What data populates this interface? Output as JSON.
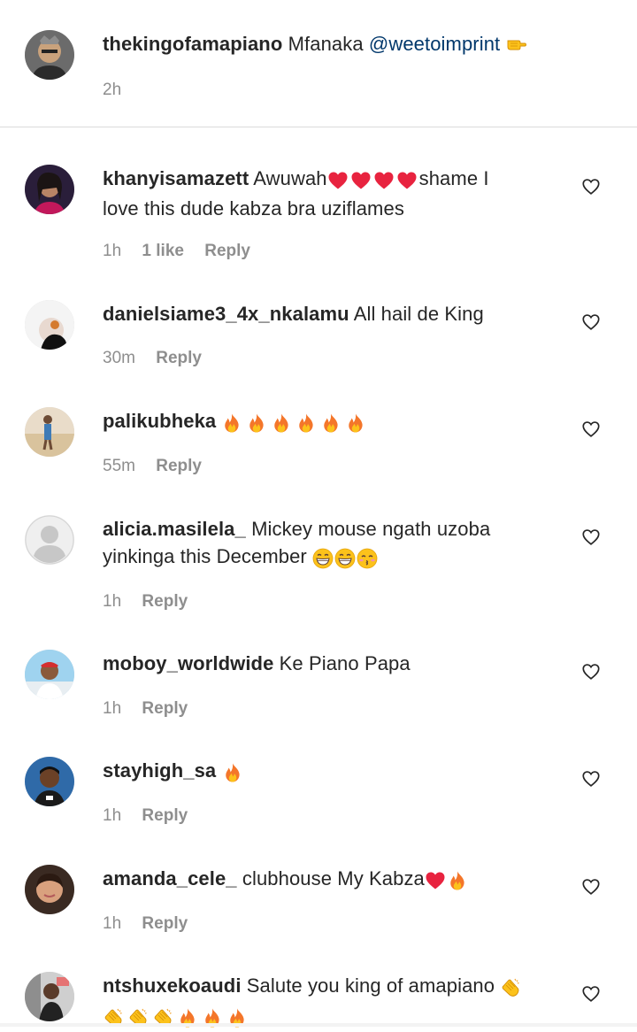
{
  "caption": {
    "username": "thekingofamapiano",
    "text": "Mfanaka",
    "mention": "@weetoimprint",
    "time": "2h",
    "emoji": "pointing-hand-icon"
  },
  "comments": [
    {
      "username": "khanyisamazett",
      "text_before": "Awuwah",
      "emoji_inline": [
        "heart",
        "heart",
        "heart",
        "heart"
      ],
      "text_after": "shame I",
      "line2": "love this dude kabza bra uziflames",
      "time": "1h",
      "likes": "1 like",
      "reply": "Reply"
    },
    {
      "username": "danielsiame3_4x_nkalamu",
      "text": "All hail de King",
      "time": "30m",
      "reply": "Reply"
    },
    {
      "username": "palikubheka",
      "emoji_inline": [
        "fire",
        "fire",
        "fire",
        "fire",
        "fire",
        "fire"
      ],
      "time": "55m",
      "reply": "Reply"
    },
    {
      "username": "alicia.masilela_",
      "text": "Mickey mouse ngath uzoba",
      "line2": "yinkinga this December",
      "emoji_line2": [
        "grin",
        "grin",
        "kiss"
      ],
      "time": "1h",
      "reply": "Reply"
    },
    {
      "username": "moboy_worldwide",
      "text": "Ke Piano Papa",
      "time": "1h",
      "reply": "Reply"
    },
    {
      "username": "stayhigh_sa",
      "emoji_inline": [
        "fire"
      ],
      "time": "1h",
      "reply": "Reply"
    },
    {
      "username": "amanda_cele_",
      "text": "clubhouse My Kabza",
      "emoji_inline": [
        "heart",
        "fire"
      ],
      "time": "1h",
      "reply": "Reply"
    },
    {
      "username": "ntshuxekoaudi",
      "text": "Salute you king of amapiano",
      "emoji_inline": [
        "clap"
      ],
      "emoji_line2": [
        "clap",
        "clap",
        "clap",
        "fire",
        "fire",
        "fire"
      ]
    }
  ],
  "colors": {
    "text": "#262626",
    "meta": "#8e8e8e",
    "mention": "#00376b",
    "divider": "#dbdbdb",
    "heart_red": "#e8233f",
    "fire_orange": "#f4762a"
  }
}
